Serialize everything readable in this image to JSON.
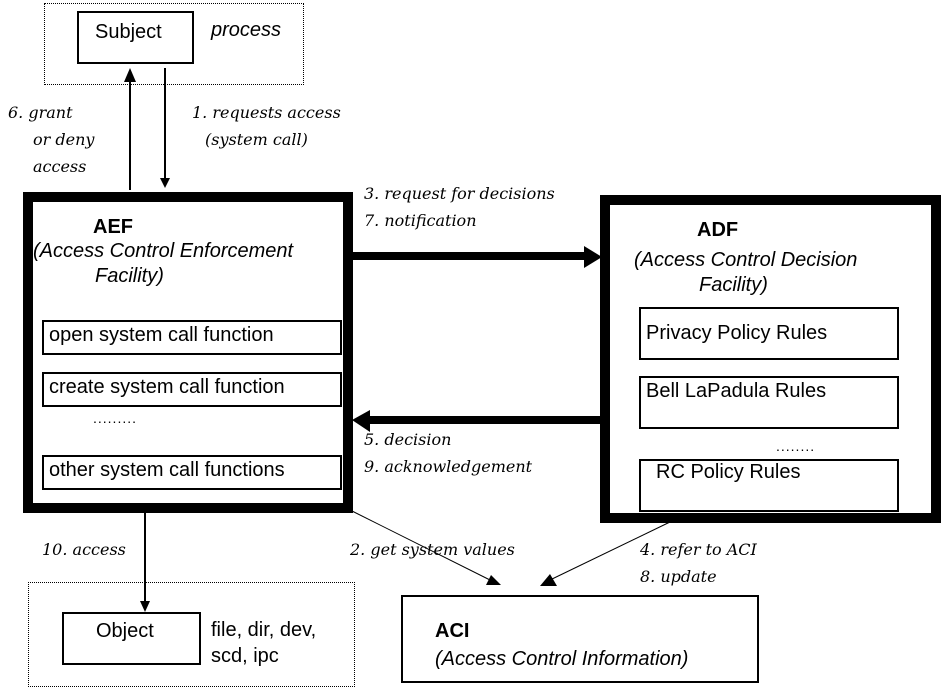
{
  "subject": {
    "title": "Subject",
    "note": "process"
  },
  "aef": {
    "title": "AEF",
    "subtitle_line1": "(Access Control Enforcement",
    "subtitle_line2": "Facility)",
    "functions": [
      "open system call function",
      "create system call function",
      "other system call functions"
    ],
    "ellipsis": "........."
  },
  "adf": {
    "title": "ADF",
    "subtitle_line1": "(Access Control Decision",
    "subtitle_line2": "Facility)",
    "rules": [
      "Privacy Policy Rules",
      "Bell LaPadula Rules",
      "RC Policy Rules"
    ],
    "ellipsis": "........"
  },
  "aci": {
    "title": "ACI",
    "subtitle": "(Access Control Information)"
  },
  "object": {
    "title": "Object",
    "note_line1": "file, dir, dev,",
    "note_line2": "scd, ipc"
  },
  "edges": {
    "grant_line1": "6. grant",
    "grant_line2": "or deny",
    "grant_line3": "access",
    "request_line1": "1. requests access",
    "request_line2": "(system call)",
    "decisions_line1": "3. request for decisions",
    "decisions_line2": "7. notification",
    "decision_line1": "5. decision",
    "decision_line2": "9. acknowledgement",
    "access": "10. access",
    "get_values": "2. get system values",
    "refer_line1": "4. refer to ACI",
    "refer_line2": "8. update"
  }
}
